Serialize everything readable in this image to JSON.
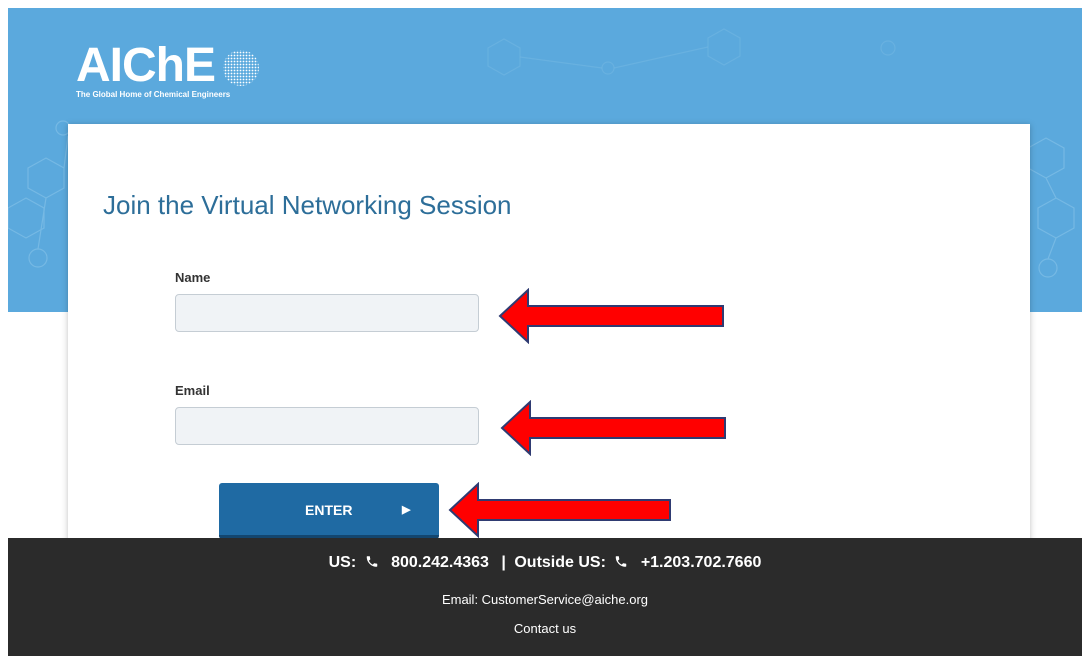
{
  "brand": {
    "logo_text": "AIChE",
    "tagline": "The Global Home of Chemical Engineers"
  },
  "form": {
    "title": "Join the Virtual Networking Session",
    "name_label": "Name",
    "name_value": "",
    "email_label": "Email",
    "email_value": "",
    "enter_label": "ENTER",
    "enter_arrow": "▶"
  },
  "footer": {
    "us_label": "US:",
    "us_phone": "800.242.4363",
    "separator": "|",
    "outside_label": "Outside US:",
    "outside_phone": "+1.203.702.7660",
    "email_text": "Email: CustomerService@aiche.org",
    "contact_label": "Contact us"
  },
  "colors": {
    "hero_blue": "#5ba9dd",
    "title_blue": "#2d6e99",
    "button_blue": "#1f6aa3",
    "footer_bg": "#2b2b2b",
    "annotation_arrow": "#ff0000"
  },
  "annotations": [
    {
      "points_to": "name-input",
      "icon": "red-arrow-left"
    },
    {
      "points_to": "email-input",
      "icon": "red-arrow-left"
    },
    {
      "points_to": "enter-button",
      "icon": "red-arrow-left"
    }
  ]
}
